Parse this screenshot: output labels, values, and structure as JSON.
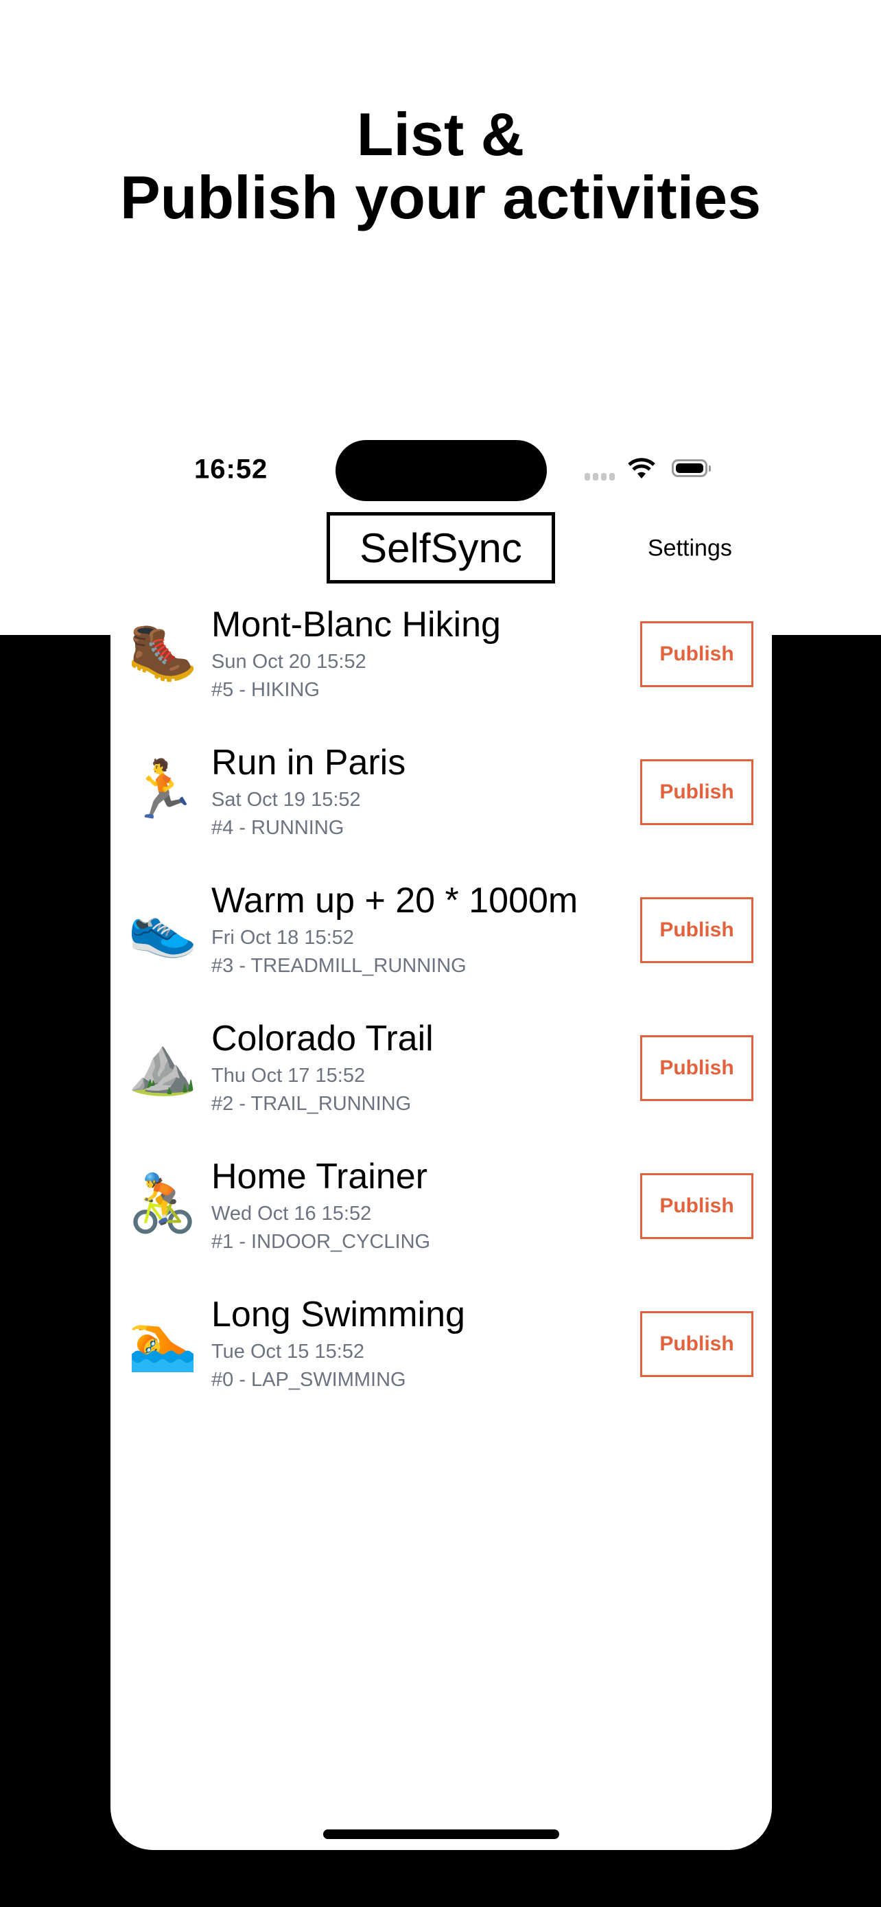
{
  "headline": {
    "line1": "List &",
    "line2": "Publish your activities"
  },
  "status_bar": {
    "time": "16:52"
  },
  "app": {
    "logo": "SelfSync",
    "settings_label": "Settings"
  },
  "colors": {
    "accent": "#e2623d",
    "secondary_text": "#6b7280"
  },
  "activities": [
    {
      "emoji": "🥾",
      "icon": "hiking-boot-icon",
      "title": "Mont-Blanc Hiking",
      "date": "Sun Oct 20 15:52",
      "type": "#5 - HIKING",
      "action": "Publish"
    },
    {
      "emoji": "🏃",
      "icon": "runner-icon",
      "title": "Run in Paris",
      "date": "Sat Oct 19 15:52",
      "type": "#4 - RUNNING",
      "action": "Publish"
    },
    {
      "emoji": "👟",
      "icon": "sneaker-icon",
      "title": "Warm up + 20 * 1000m",
      "date": "Fri Oct 18 15:52",
      "type": "#3 - TREADMILL_RUNNING",
      "action": "Publish"
    },
    {
      "emoji": "⛰️",
      "icon": "mountain-icon",
      "title": "Colorado Trail",
      "date": "Thu Oct 17 15:52",
      "type": "#2 - TRAIL_RUNNING",
      "action": "Publish"
    },
    {
      "emoji": "🚴",
      "icon": "cyclist-icon",
      "title": "Home Trainer",
      "date": "Wed Oct 16 15:52",
      "type": "#1 - INDOOR_CYCLING",
      "action": "Publish"
    },
    {
      "emoji": "🏊",
      "icon": "swimmer-icon",
      "title": "Long Swimming",
      "date": "Tue Oct 15 15:52",
      "type": "#0 - LAP_SWIMMING",
      "action": "Publish"
    }
  ]
}
